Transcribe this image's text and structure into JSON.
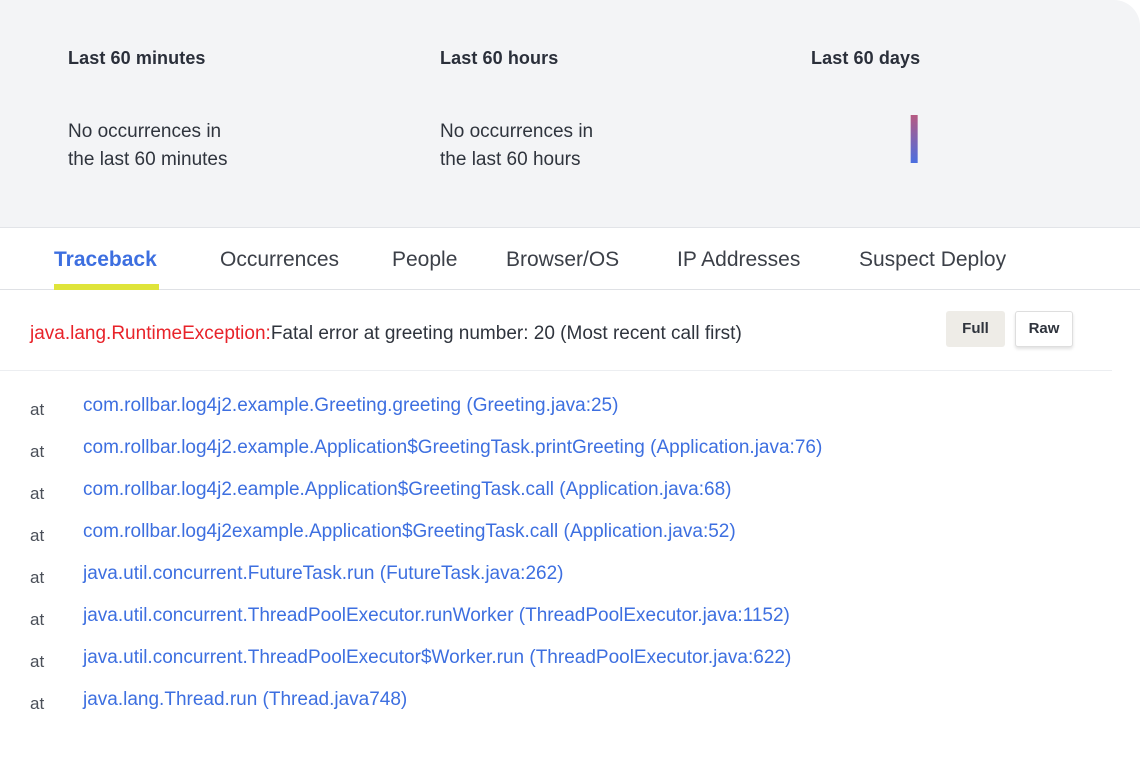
{
  "stats": [
    {
      "title": "Last 60 minutes",
      "text_line1": "No occurrences in",
      "text_line2": "the last 60 minutes"
    },
    {
      "title": "Last 60 hours",
      "text_line1": "No occurrences in",
      "text_line2": "the last 60 hours"
    },
    {
      "title": "Last 60 days"
    }
  ],
  "sparkline": {
    "type": "bar",
    "bucket_count": 24,
    "values": [
      0,
      0,
      0,
      0,
      0,
      0,
      0,
      0,
      0,
      0,
      1,
      0,
      0,
      0,
      0,
      0,
      0,
      0,
      0,
      0,
      0,
      0,
      0,
      0
    ],
    "colors": {
      "start": "#4a6ee0",
      "end": "#b65a82"
    }
  },
  "tabs": [
    "Traceback",
    "Occurrences",
    "People",
    "Browser/OS",
    "IP Addresses",
    "Suspect Deploy"
  ],
  "exception": {
    "type": "java.lang.RuntimeException:",
    "message": "Fatal error at greeting number: 20 (Most recent call first)"
  },
  "buttons": {
    "full": "Full",
    "raw": "Raw"
  },
  "frames": [
    {
      "at": "at",
      "location": "com.rollbar.log4j2.example.Greeting.greeting (Greeting.java:25)"
    },
    {
      "at": "at",
      "location": "com.rollbar.log4j2.example.Application$GreetingTask.printGreeting (Application.java:76)"
    },
    {
      "at": "at",
      "location": "com.rollbar.log4j2.eample.Application$GreetingTask.call (Application.java:68)"
    },
    {
      "at": "at",
      "location": "com.rollbar.log4j2example.Application$GreetingTask.call (Application.java:52)"
    },
    {
      "at": "at",
      "location": "java.util.concurrent.FutureTask.run (FutureTask.java:262)"
    },
    {
      "at": "at",
      "location": "java.util.concurrent.ThreadPoolExecutor.runWorker (ThreadPoolExecutor.java:1152)"
    },
    {
      "at": "at",
      "location": "java.util.concurrent.ThreadPoolExecutor$Worker.run (ThreadPoolExecutor.java:622)"
    },
    {
      "at": "at",
      "location": "java.lang.Thread.run (Thread.java748)"
    }
  ],
  "colors": {
    "accent": "#3d6fe0",
    "error": "#e8232a",
    "tab_underline": "#dfe43a"
  }
}
